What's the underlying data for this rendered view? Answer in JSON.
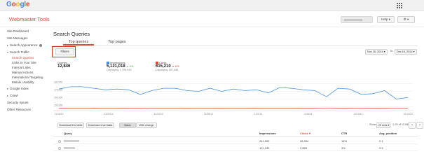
{
  "brand": {
    "logo_letters": [
      "G",
      "o",
      "o",
      "g",
      "l",
      "e"
    ],
    "logo_colors": [
      "#4285f4",
      "#ea4335",
      "#fbbc05",
      "#4285f4",
      "#34a853",
      "#ea4335"
    ]
  },
  "header": {
    "app_title": "Webmaster Tools",
    "help_label": "Help ▾",
    "gear_label": "⚙ ▾"
  },
  "sidebar": {
    "items": [
      {
        "label": "Site Dashboard"
      },
      {
        "label": "Site Messages"
      },
      {
        "label": "Search Appearance"
      },
      {
        "label": "Search Traffic"
      },
      {
        "label": "Search Queries"
      },
      {
        "label": "Links to Your Site"
      },
      {
        "label": "Internal Links"
      },
      {
        "label": "Manual Actions"
      },
      {
        "label": "International Targeting"
      },
      {
        "label": "Mobile Usability"
      },
      {
        "label": "Google Index"
      },
      {
        "label": "Crawl"
      },
      {
        "label": "Security Issues"
      },
      {
        "label": "Other Resources"
      }
    ]
  },
  "main": {
    "title": "Search Queries",
    "tabs": [
      {
        "label": "Top queries"
      },
      {
        "label": "Top pages"
      }
    ],
    "filters_label": "Filters",
    "date_from": "Nov 16, 2014 ▾",
    "to_label": "To:",
    "date_to": "Dec 16, 2014 ▾",
    "metrics": {
      "queries": {
        "label": "Queries",
        "value": "12,846"
      },
      "impressions": {
        "label": "Impressions",
        "value": "5,121,018",
        "change": "▲ 11%",
        "sub": "Displaying 1,795,945"
      },
      "clicks": {
        "label": "Clicks",
        "value": "615,210",
        "change": "▼ 10%",
        "sub": "Displaying 187,589"
      }
    },
    "table_controls": {
      "download_table": "Download this table",
      "download_chart": "Download chart data",
      "basic": "Basic",
      "with_change": "With change",
      "show_label": "Show",
      "rows_value": "25 rows ▾",
      "page_info": "1-25 of 12,846",
      "prev": "‹",
      "next": "›"
    },
    "table": {
      "headers": [
        "Query",
        "Impressions",
        "Clicks ▾",
        "CTR",
        "Avg. position"
      ],
      "rows": [
        {
          "impressions": "241,052",
          "clicks": "38,394",
          "ctr": "16%",
          "position": "2.1"
        },
        {
          "impressions": "101,132",
          "clicks": "2,855",
          "ctr": "3%",
          "position": "2.3"
        }
      ]
    }
  },
  "colors": {
    "accent": "#dd4b39",
    "impressions_line": "#4a90e2",
    "clicks_line": "#dd4b39"
  },
  "chart_data": {
    "type": "line",
    "title": "",
    "xlabel": "",
    "ylabel": "",
    "x_tick_labels": [
      "11/16/14",
      "11/20/14",
      "11/24/14",
      "11/28/14",
      "12/2/14",
      "12/6/14",
      "12/10/14",
      "12/14/14"
    ],
    "y_tick_labels": [
      "180,000",
      "170,000",
      "160,000",
      "150,000"
    ],
    "ylim": [
      145000,
      185000
    ],
    "series": [
      {
        "name": "Impressions",
        "color": "#4a90e2",
        "values": [
          173000,
          176000,
          176000,
          174000,
          172000,
          173000,
          172000,
          166000,
          171000,
          174000,
          174000,
          171000,
          170000,
          174000,
          170000,
          173000,
          171000,
          172000,
          168000,
          175000,
          174000,
          172000,
          171000,
          163000,
          174000,
          173000,
          166000,
          167000,
          171000,
          160000,
          162000
        ]
      },
      {
        "name": "Clicks",
        "color": "#dd4b39",
        "values": [
          148000,
          148200,
          148100,
          148300,
          148100,
          148200,
          148000,
          147900,
          148100,
          148200,
          148100,
          148000,
          148100,
          148200,
          148000,
          148100,
          148200,
          148000,
          148100,
          148300,
          148200,
          148000,
          148100,
          147800,
          148100,
          148000,
          147900,
          148000,
          148100,
          147800,
          147900
        ]
      }
    ],
    "grid": true,
    "legend": "none"
  }
}
